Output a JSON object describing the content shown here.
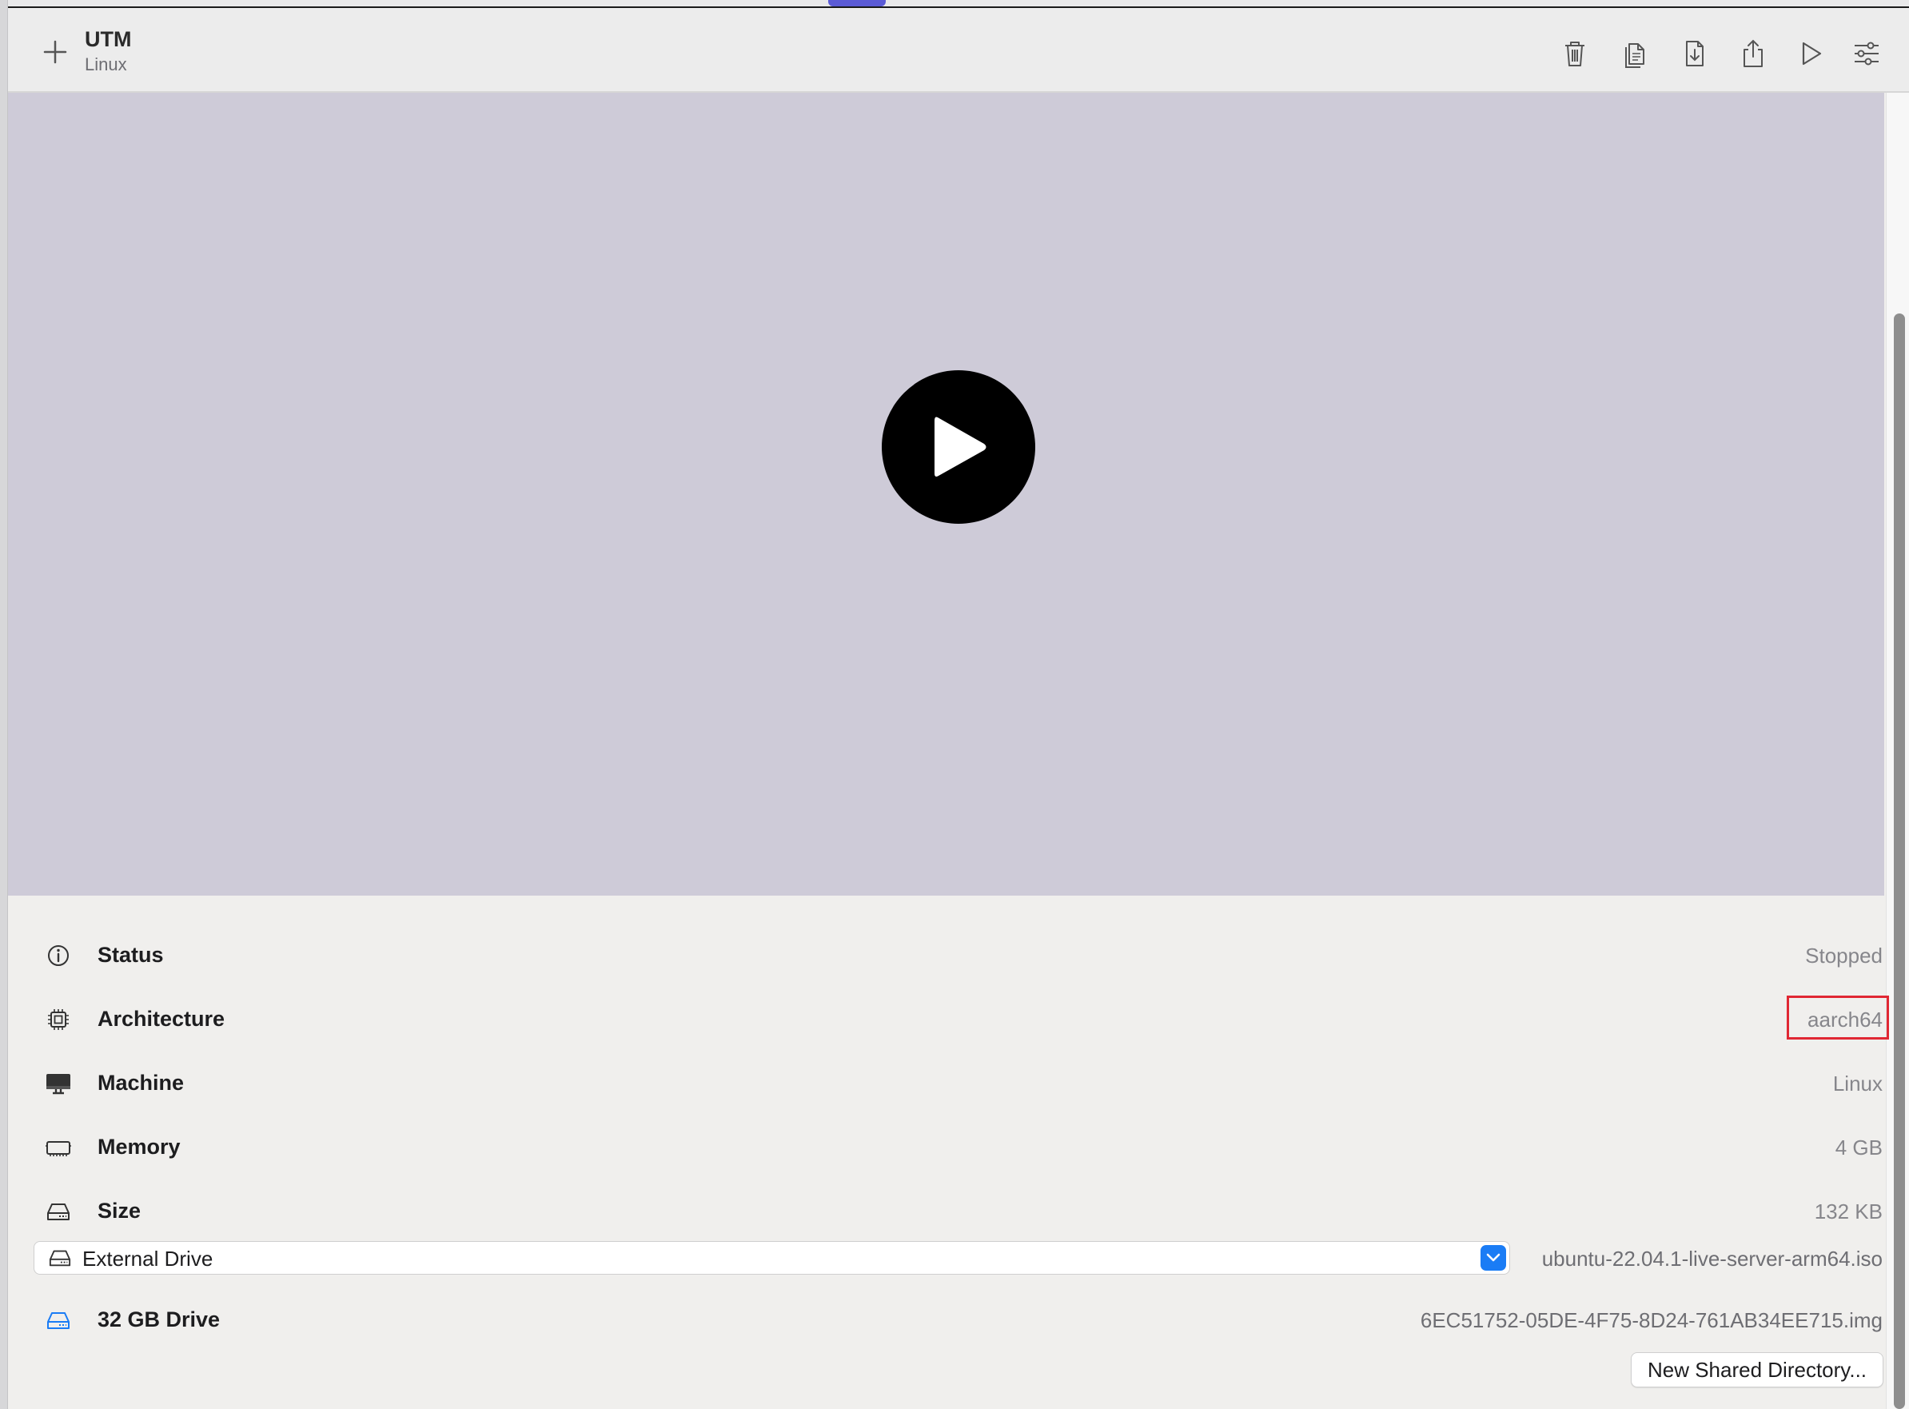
{
  "toolbar": {
    "title": "UTM",
    "subtitle": "Linux",
    "icons": [
      "plus-icon",
      "trash-icon",
      "clone-icon",
      "download-icon",
      "share-icon",
      "play-icon",
      "sliders-icon"
    ]
  },
  "details": {
    "status": {
      "label": "Status",
      "value": "Stopped",
      "icon": "info-circle-icon"
    },
    "architecture": {
      "label": "Architecture",
      "value": "aarch64",
      "icon": "cpu-chip-icon"
    },
    "machine": {
      "label": "Machine",
      "value": "Linux",
      "icon": "display-icon"
    },
    "memory": {
      "label": "Memory",
      "value": "4 GB",
      "icon": "memory-chip-icon"
    },
    "size": {
      "label": "Size",
      "value": "132 KB",
      "icon": "drive-icon"
    }
  },
  "removable_drive": {
    "selected": "External Drive",
    "file": "ubuntu-22.04.1-live-server-arm64.iso"
  },
  "drive": {
    "label": "32 GB Drive",
    "file": "6EC51752-05DE-4F75-8D24-761AB34EE715.img",
    "accent": "#1a7cf5"
  },
  "shared_directory": {
    "button_label": "New Shared Directory..."
  },
  "colors": {
    "highlight": "#e02733",
    "accent": "#1a7cf5",
    "preview_bg": "#cecbd8"
  }
}
